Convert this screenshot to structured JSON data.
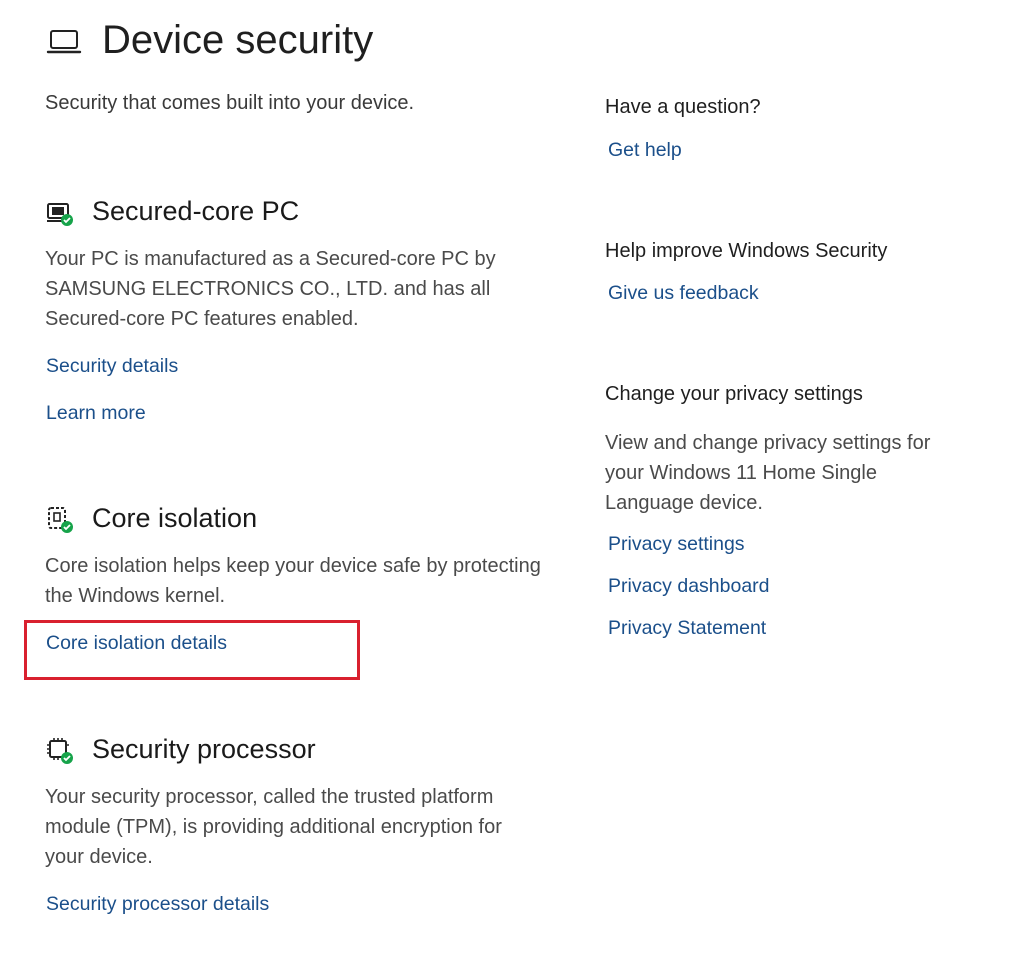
{
  "header": {
    "title": "Device security",
    "subtitle": "Security that comes built into your device.",
    "icon": "laptop-icon"
  },
  "sections": [
    {
      "title": "Secured-core PC",
      "icon": "secured-core-pc-icon",
      "description": "Your PC is manufactured as a Secured-core PC by SAMSUNG ELECTRONICS CO., LTD. and has all Secured-core PC features enabled.",
      "links": [
        "Security details",
        "Learn more"
      ]
    },
    {
      "title": "Core isolation",
      "icon": "core-isolation-icon",
      "description": "Core isolation helps keep your device safe by protecting the Windows kernel.",
      "links": [
        "Core isolation details"
      ]
    },
    {
      "title": "Security processor",
      "icon": "security-processor-icon",
      "description": "Your security processor, called the trusted platform module (TPM), is providing additional encryption for your device.",
      "links": [
        "Security processor details"
      ]
    }
  ],
  "sidebar": {
    "question": {
      "heading": "Have a question?",
      "link": "Get help"
    },
    "improve": {
      "heading": "Help improve Windows Security",
      "link": "Give us feedback"
    },
    "privacy": {
      "heading": "Change your privacy settings",
      "description": "View and change privacy settings for your Windows 11 Home Single Language device.",
      "links": [
        "Privacy settings",
        "Privacy dashboard",
        "Privacy Statement"
      ]
    }
  },
  "colors": {
    "link": "#1b4f8a",
    "check": "#16a34a",
    "highlight": "#d9202f"
  }
}
